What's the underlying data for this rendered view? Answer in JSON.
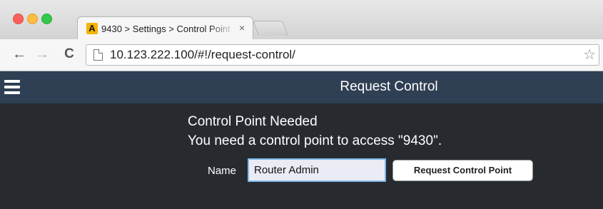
{
  "browser": {
    "tab": {
      "favicon": "A",
      "title": "9430 > Settings > Control Point",
      "close_glyph": "×"
    },
    "url": "10.123.222.100/#!/request-control/",
    "icons": {
      "back": "←",
      "forward": "→",
      "reload": "C",
      "star": "☆"
    }
  },
  "app": {
    "header_title": "Request Control",
    "heading": "Control Point Needed",
    "message": "You need a control point to access \"9430\".",
    "name_label": "Name",
    "name_value": "Router Admin",
    "request_button": "Request Control Point"
  },
  "colors": {
    "app_background": "#272b30",
    "header_background": "#2f3f54",
    "input_border": "#7fb9e8",
    "favicon": "#f4b400"
  }
}
